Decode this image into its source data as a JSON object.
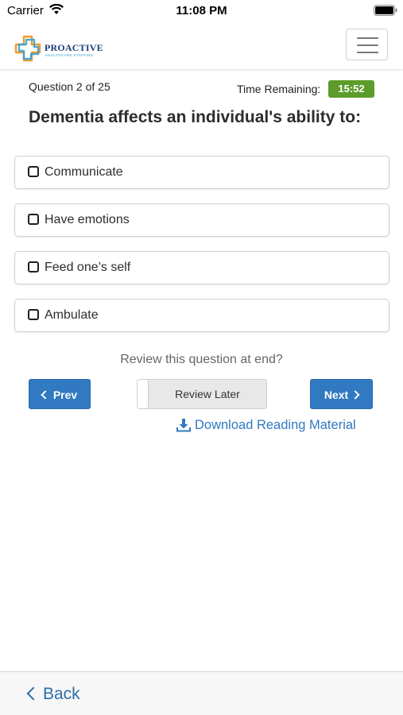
{
  "status_bar": {
    "carrier": "Carrier",
    "time": "11:08 PM",
    "icons": [
      "wifi-icon",
      "battery-icon"
    ]
  },
  "header": {
    "logo_name": "PROACTIVE",
    "logo_subtitle": "HEALTHCARE STAFFING",
    "menu_icon": "hamburger-menu-icon",
    "brand_colors": {
      "navy": "#1b3f7a",
      "blue": "#2a9fd6",
      "orange": "#f39a2b"
    }
  },
  "quiz": {
    "counter": "Question 2 of 25",
    "time_label": "Time Remaining:",
    "time_remaining": "15:52",
    "question": "Dementia affects an individual's ability to:",
    "options": [
      {
        "label": "Communicate",
        "checked": false
      },
      {
        "label": "Have emotions",
        "checked": false
      },
      {
        "label": "Feed one’s self",
        "checked": false
      },
      {
        "label": "Ambulate",
        "checked": false
      }
    ],
    "review_prompt": "Review this question at end?",
    "prev_label": "Prev",
    "next_label": "Next",
    "review_toggle_label": "Review Later",
    "review_toggle_on": false,
    "download_label": "Download Reading Material"
  },
  "colors": {
    "primary": "#3179c1",
    "timer": "#5d9c2b",
    "link": "#3179c1"
  },
  "toolbar": {
    "back_label": "Back"
  }
}
